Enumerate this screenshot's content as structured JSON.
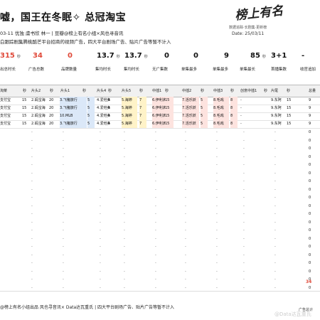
{
  "header": {
    "title": "嘘，国王在冬眠✧ 总冠淘宝",
    "meta_line1": "03-11 优独 虞书欣 林一 | 豆瓣@榜上有名小组×风也寻音讯",
    "meta_line2": "白跟踪剧集腾桃酷芒平台招商的视频广告，四大平台剧场广告、贴片广告等暂不计入"
  },
  "logo": {
    "text": "榜上有名",
    "subtitle": "数据追踪·长剧集·更新榜",
    "date": "Date: 25/03/11"
  },
  "stats": [
    {
      "value": "315",
      "unit": "秒",
      "color": "#e04a3a"
    },
    {
      "value": "34",
      "unit": "",
      "color": "#e04a3a"
    },
    {
      "value": "0",
      "unit": "",
      "color": "#e04a3a"
    },
    {
      "value": "13.7",
      "unit": "秒",
      "color": "#111111"
    },
    {
      "value": "13.7",
      "unit": "秒",
      "color": "#111111"
    },
    {
      "value": "0",
      "unit": "",
      "color": "#111111"
    },
    {
      "value": "0",
      "unit": "",
      "color": "#111111"
    },
    {
      "value": "9",
      "unit": "",
      "color": "#111111"
    },
    {
      "value": "85",
      "unit": "秒",
      "color": "#111111"
    },
    {
      "value": "3+1",
      "unit": "",
      "color": "#111111"
    },
    {
      "value": "-",
      "unit": "",
      "color": "#111111"
    }
  ],
  "stat_labels": [
    "出总时长",
    "广告总数",
    "品牌数量",
    "集均时长",
    "集均时长",
    "无广集数",
    "单集最多",
    "单集最多",
    "单集最长",
    "首播集数",
    "收官追加"
  ],
  "table_headers": [
    "淘菜",
    "秒",
    "片头2",
    "秒",
    "片头1",
    "秒",
    "片头4",
    "秒",
    "片头5",
    "秒",
    "中插1",
    "秒",
    "中插2",
    "秒",
    "中插3",
    "秒",
    "创意中插1",
    "秒",
    "片尾",
    "秒",
    "总量"
  ],
  "rows": [
    {
      "brand": "支付宝",
      "s0": "15",
      "p2": "2.蚂宝海",
      "s1": "20",
      "p1": "3.飞猪旅行",
      "s2": "5",
      "p4": "4.爱他美",
      "s3": "5",
      "p5": "5.海婷",
      "s4": "7",
      "m1": "6.伊利满哈",
      "s5": "15",
      "m2": "7.活乐妖",
      "s6": "5",
      "m3": "8.毛戏",
      "s7": "8",
      "cm": "-",
      "s8": "",
      "end": "9.东阿",
      "s9": "15",
      "total": "9"
    },
    {
      "brand": "支付宝",
      "s0": "15",
      "p2": "2.蚂宝海",
      "s1": "20",
      "p1": "3.飞猪旅行",
      "s2": "5",
      "p4": "4.爱他美",
      "s3": "5",
      "p5": "5.海婷",
      "s4": "7",
      "m1": "6.伊利满哈",
      "s5": "15",
      "m2": "7.活乐妖",
      "s6": "5",
      "m3": "8.毛戏",
      "s7": "8",
      "cm": "-",
      "s8": "",
      "end": "9.东阿",
      "s9": "15",
      "total": "9"
    },
    {
      "brand": "支付宝",
      "s0": "15",
      "p2": "2.蚂宝海",
      "s1": "20",
      "p1": "10.MLB",
      "s2": "5",
      "p4": "4.爱他美",
      "s3": "5",
      "p5": "5.海婷",
      "s4": "7",
      "m1": "6.伊利满哈",
      "s5": "15",
      "m2": "7.活乐妖",
      "s6": "5",
      "m3": "8.毛戏",
      "s7": "8",
      "cm": "-",
      "s8": "",
      "end": "9.东阿",
      "s9": "15",
      "total": "9"
    },
    {
      "brand": "支付宝",
      "s0": "15",
      "p2": "2.蚂宝海",
      "s1": "20",
      "p1": "3.飞猪旅行",
      "s2": "5",
      "p4": "4.爱他美",
      "s3": "5",
      "p5": "5.海婷",
      "s4": "7",
      "m1": "6.伊利满哈",
      "s5": "15",
      "m2": "7.活乐妖",
      "s6": "5",
      "m3": "8.毛戏",
      "s7": "8",
      "cm": "-",
      "s8": "",
      "end": "9.东阿",
      "s9": "15",
      "total": "9"
    }
  ],
  "blank_rows": {
    "dash": "-",
    "zero": "0"
  },
  "footer": {
    "total": "34",
    "text": "@榜上有名小组出品 风也寻音讯× Data达瓦重氏 | 四大平台剧场广告、贴片广告等暂不计入",
    "label": "广告总计"
  },
  "watermark": "@Data达瓦重氏",
  "colors": {
    "accent": "#e04a3a",
    "p1_bg": "#dbe8f8",
    "p5_bg": "#fff3c8",
    "m_bg": "#fde3df",
    "header_bg": "#f1f1f1"
  }
}
